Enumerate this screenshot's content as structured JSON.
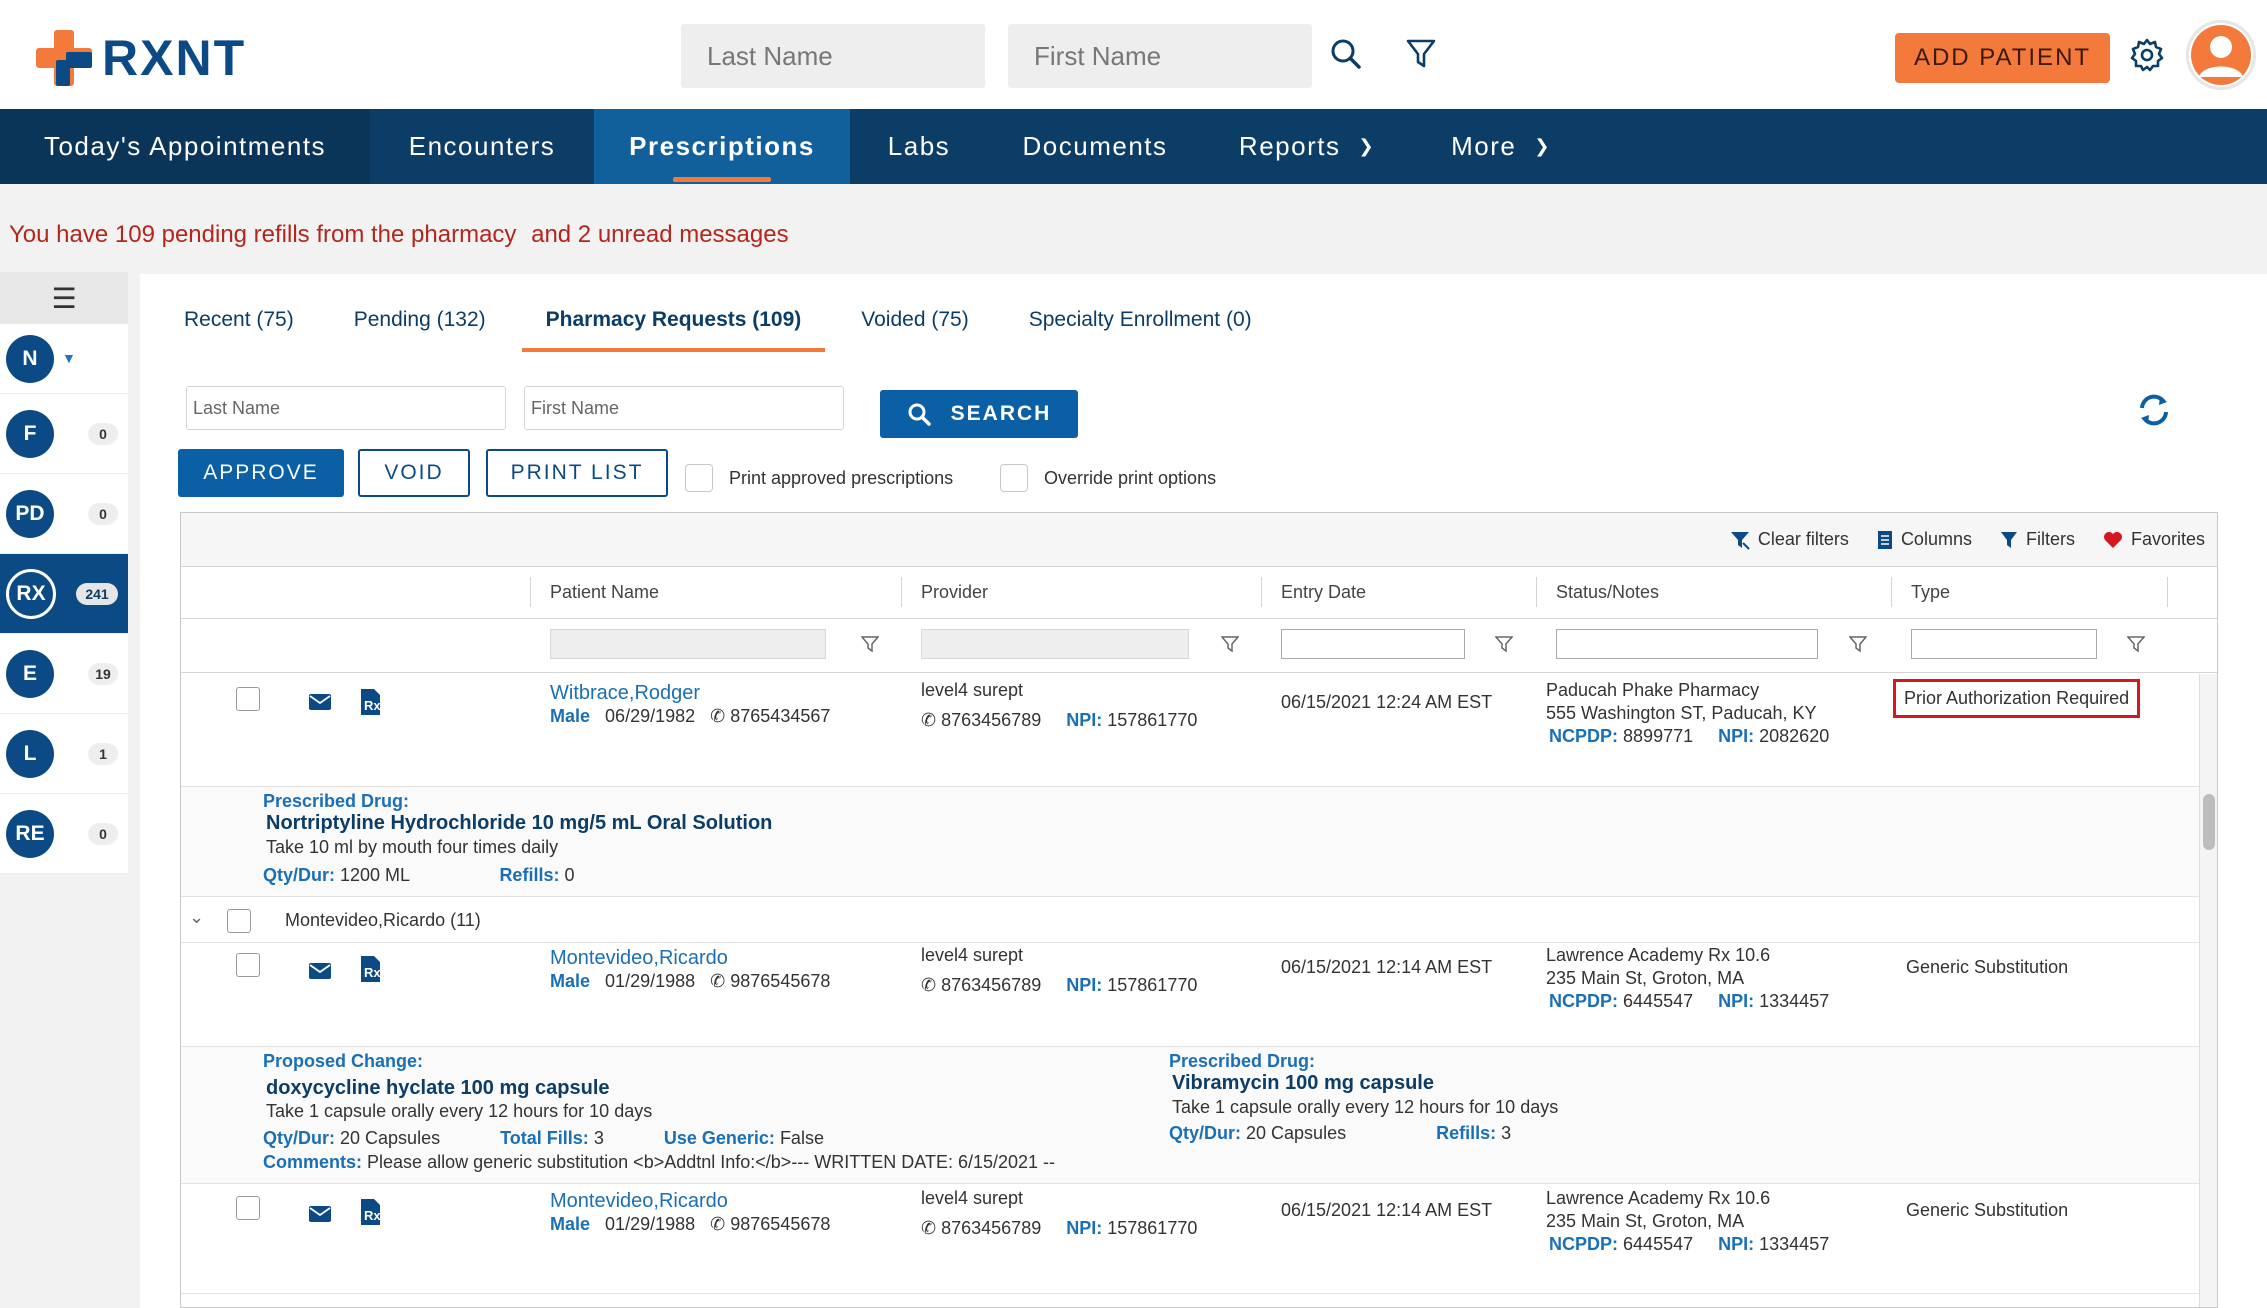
{
  "app": {
    "logo_text": "RXNT"
  },
  "header": {
    "last_name_placeholder": "Last Name",
    "first_name_placeholder": "First Name",
    "add_patient_label": "ADD PATIENT"
  },
  "nav": {
    "items": [
      {
        "label": "Today's Appointments"
      },
      {
        "label": "Encounters"
      },
      {
        "label": "Prescriptions"
      },
      {
        "label": "Labs"
      },
      {
        "label": "Documents"
      },
      {
        "label": "Reports"
      },
      {
        "label": "More"
      }
    ]
  },
  "alert": {
    "refills_text": "You have 109 pending refills from the pharmacy",
    "messages_text": "and 2 unread messages"
  },
  "rail": {
    "items": [
      {
        "initials": "N",
        "badge": ""
      },
      {
        "initials": "F",
        "badge": "0"
      },
      {
        "initials": "PD",
        "badge": "0"
      },
      {
        "initials": "RX",
        "badge": "241"
      },
      {
        "initials": "E",
        "badge": "19"
      },
      {
        "initials": "L",
        "badge": "1"
      },
      {
        "initials": "RE",
        "badge": "0"
      }
    ]
  },
  "tabs": [
    {
      "label": "Recent (75)"
    },
    {
      "label": "Pending (132)"
    },
    {
      "label": "Pharmacy Requests (109)"
    },
    {
      "label": "Voided (75)"
    },
    {
      "label": "Specialty Enrollment (0)"
    }
  ],
  "search": {
    "last_name_placeholder": "Last Name",
    "first_name_placeholder": "First Name",
    "search_label": "SEARCH"
  },
  "actions": {
    "approve": "APPROVE",
    "void": "VOID",
    "print_list": "PRINT LIST",
    "print_approved": "Print approved prescriptions",
    "override_print": "Override print options"
  },
  "toolbar": {
    "clear_filters": "Clear filters",
    "columns": "Columns",
    "filters": "Filters",
    "favorites": "Favorites"
  },
  "columns": {
    "patient_name": "Patient Name",
    "provider": "Provider",
    "entry_date": "Entry Date",
    "status_notes": "Status/Notes",
    "type": "Type"
  },
  "labels": {
    "npi": "NPI:",
    "ncpdp": "NCPDP:",
    "prescribed_drug": "Prescribed Drug:",
    "proposed_change": "Proposed Change:",
    "qty_dur": "Qty/Dur:",
    "refills": "Refills:",
    "total_fills": "Total Fills:",
    "use_generic": "Use Generic:",
    "comments": "Comments:"
  },
  "rows": [
    {
      "patient": "Witbrace,Rodger",
      "gender": "Male",
      "dob": "06/29/1982",
      "phone": "8765434567",
      "provider": "level4 surept",
      "provider_phone": "8763456789",
      "provider_npi": "157861770",
      "entry_date": "06/15/2021 12:24 AM EST",
      "pharmacy": "Paducah Phake Pharmacy",
      "address": "555 Washington ST, Paducah, KY",
      "ncpdp": "8899771",
      "pharm_npi": "2082620",
      "type": "Prior Authorization Required",
      "drug": "Nortriptyline Hydrochloride 10 mg/5 mL Oral Solution",
      "sig": "Take 10 ml by mouth four times daily",
      "qty": "1200 ML",
      "refills": "0"
    },
    {
      "patient": "Montevideo,Ricardo",
      "gender": "Male",
      "dob": "01/29/1988",
      "phone": "9876545678",
      "provider": "level4 surept",
      "provider_phone": "8763456789",
      "provider_npi": "157861770",
      "entry_date": "06/15/2021 12:14 AM EST",
      "pharmacy": "Lawrence Academy Rx 10.6",
      "address": "235 Main St, Groton, MA",
      "ncpdp": "6445547",
      "pharm_npi": "1334457",
      "type": "Generic Substitution",
      "proposed_drug": "doxycycline hyclate 100 mg capsule",
      "proposed_sig": "Take 1 capsule orally every 12 hours for 10 days",
      "proposed_qty": "20 Capsules",
      "total_fills": "3",
      "use_generic": "False",
      "comments": "Please allow generic substitution <b>Addtnl Info:</b>--- WRITTEN DATE: 6/15/2021 --",
      "drug": "Vibramycin 100 mg capsule",
      "sig": "Take 1 capsule orally every 12 hours for 10 days",
      "qty": "20 Capsules",
      "refills": "3"
    },
    {
      "patient": "Montevideo,Ricardo",
      "gender": "Male",
      "dob": "01/29/1988",
      "phone": "9876545678",
      "provider": "level4 surept",
      "provider_phone": "8763456789",
      "provider_npi": "157861770",
      "entry_date": "06/15/2021 12:14 AM EST",
      "pharmacy": "Lawrence Academy Rx 10.6",
      "address": "235 Main St, Groton, MA",
      "ncpdp": "6445547",
      "pharm_npi": "1334457",
      "type": "Generic Substitution"
    }
  ],
  "group": {
    "label": "Montevideo,Ricardo (11)"
  },
  "colors": {
    "brand": "#0b3d66",
    "accent": "#f47a3c",
    "alert": "#b3261e",
    "link": "#1a6fb5",
    "highlight": "#d5171f"
  },
  "icons": [
    "search-icon",
    "filter-icon",
    "gear-icon",
    "user-avatar-icon",
    "menu-icon",
    "refresh-icon",
    "mail-icon",
    "rx-icon",
    "phone-icon",
    "heart-icon"
  ]
}
